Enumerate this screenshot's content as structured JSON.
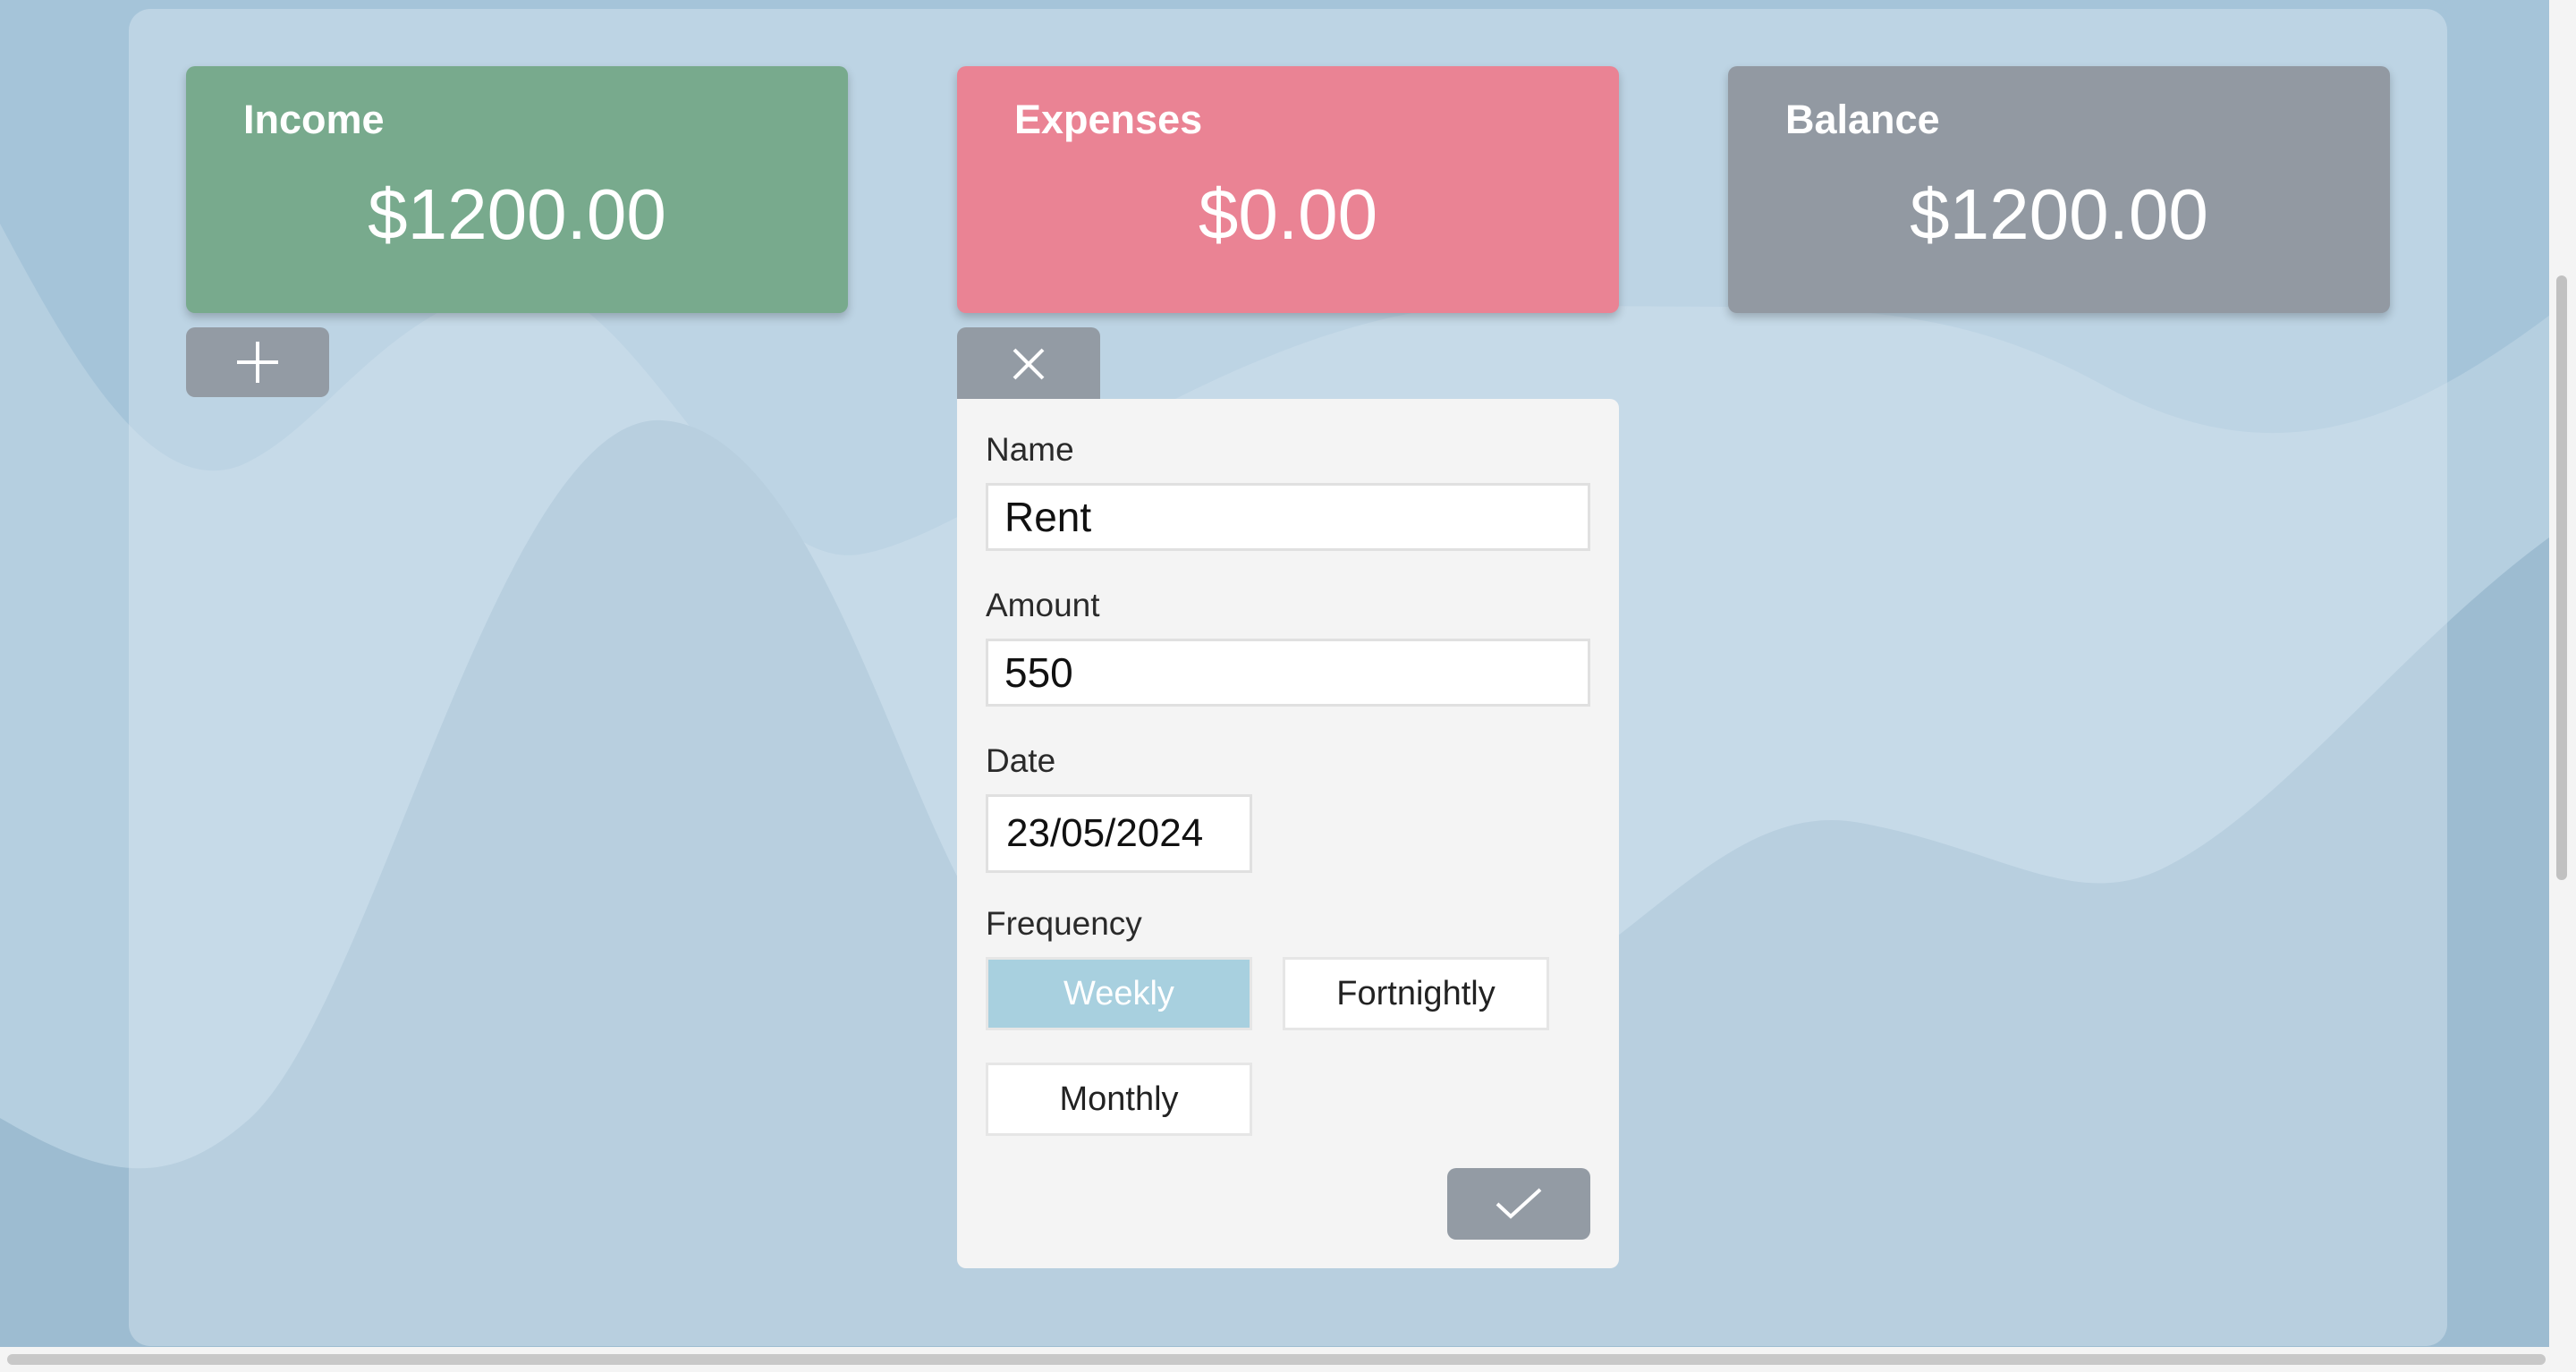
{
  "summary": {
    "income": {
      "title": "Income",
      "amount": "$1200.00",
      "color": "#78aa8d"
    },
    "expenses": {
      "title": "Expenses",
      "amount": "$0.00",
      "color": "#ea8394"
    },
    "balance": {
      "title": "Balance",
      "amount": "$1200.00",
      "color": "#9299a2"
    }
  },
  "controls": {
    "add_icon": "plus-icon",
    "close_icon": "close-icon",
    "submit_icon": "check-icon"
  },
  "expense_form": {
    "name_label": "Name",
    "name_value": "Rent",
    "amount_label": "Amount",
    "amount_value": "550",
    "date_label": "Date",
    "date_value": "23/05/2024",
    "frequency_label": "Frequency",
    "frequency_options": [
      "Weekly",
      "Fortnightly",
      "Monthly"
    ],
    "frequency_selected": "Weekly",
    "selected_color": "#a8d0df"
  }
}
